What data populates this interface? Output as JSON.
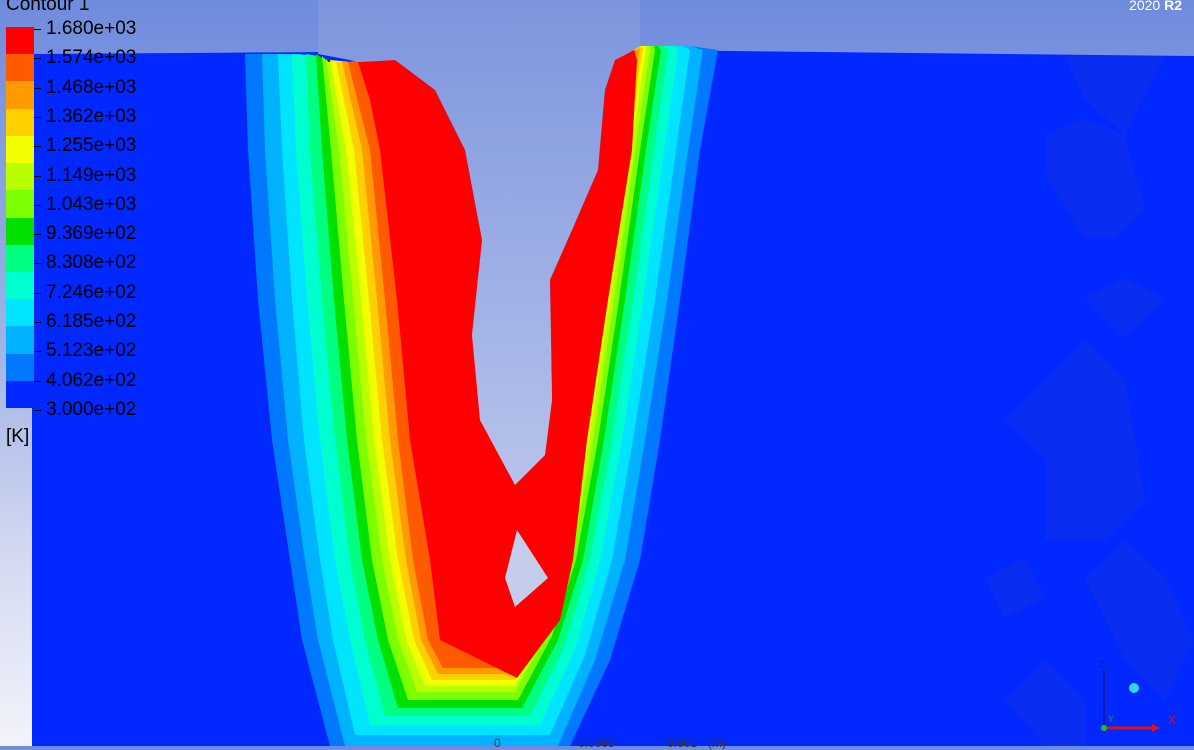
{
  "legend": {
    "title": "Contour 1",
    "unit": "[K]",
    "labels": [
      "1.680e+03",
      "1.574e+03",
      "1.468e+03",
      "1.362e+03",
      "1.255e+03",
      "1.149e+03",
      "1.043e+03",
      "9.369e+02",
      "8.308e+02",
      "7.246e+02",
      "6.185e+02",
      "5.123e+02",
      "4.062e+02",
      "3.000e+02"
    ],
    "colors": [
      "#ff0000",
      "#ff5a00",
      "#ff9a00",
      "#ffd000",
      "#f2ff00",
      "#b8ff00",
      "#7cff00",
      "#00e000",
      "#00ff80",
      "#00ffd0",
      "#00e4ff",
      "#00b2ff",
      "#0078ff",
      "#0028ff"
    ]
  },
  "version": {
    "year": "2020",
    "release": "R2"
  },
  "scale": {
    "labels": [
      "0",
      "0.0005",
      "0.001",
      "(m)"
    ]
  },
  "triad": {
    "x_label": "X",
    "y_label": "Y",
    "z_label": "Z"
  }
}
